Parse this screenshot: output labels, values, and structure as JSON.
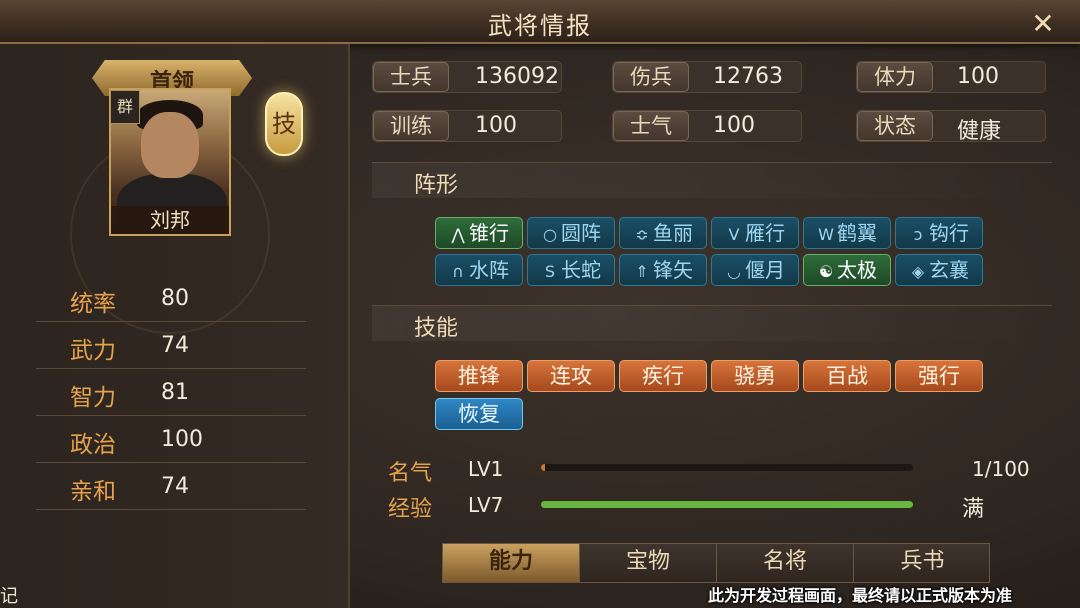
{
  "window": {
    "title": "武将情报",
    "close_label": "✕"
  },
  "general": {
    "leader_label": "首领",
    "faction": "群",
    "name": "刘邦",
    "skill_badge": "技",
    "stats": [
      {
        "label": "统率",
        "value": "80"
      },
      {
        "label": "武力",
        "value": "74"
      },
      {
        "label": "智力",
        "value": "81"
      },
      {
        "label": "政治",
        "value": "100"
      },
      {
        "label": "亲和",
        "value": "74"
      }
    ]
  },
  "info": [
    {
      "label": "士兵",
      "value": "136092"
    },
    {
      "label": "伤兵",
      "value": "12763"
    },
    {
      "label": "体力",
      "value": "100"
    },
    {
      "label": "训练",
      "value": "100"
    },
    {
      "label": "士气",
      "value": "100"
    },
    {
      "label": "状态",
      "value": "健康"
    }
  ],
  "formations": {
    "title": "阵形",
    "items": [
      {
        "label": "锥行",
        "icon": "⋀",
        "active": true
      },
      {
        "label": "圆阵",
        "icon": "○",
        "active": false
      },
      {
        "label": "鱼丽",
        "icon": "≎",
        "active": false
      },
      {
        "label": "雁行",
        "icon": "V",
        "active": false
      },
      {
        "label": "鹤翼",
        "icon": "W",
        "active": false
      },
      {
        "label": "钩行",
        "icon": "ↄ",
        "active": false
      },
      {
        "label": "水阵",
        "icon": "∩",
        "active": false
      },
      {
        "label": "长蛇",
        "icon": "S",
        "active": false
      },
      {
        "label": "锋矢",
        "icon": "⇑",
        "active": false
      },
      {
        "label": "偃月",
        "icon": "◡",
        "active": false
      },
      {
        "label": "太极",
        "icon": "☯",
        "active": true
      },
      {
        "label": "玄襄",
        "icon": "◈",
        "active": false
      }
    ]
  },
  "skills": {
    "title": "技能",
    "items": [
      {
        "label": "推锋",
        "color": "orange"
      },
      {
        "label": "连攻",
        "color": "orange"
      },
      {
        "label": "疾行",
        "color": "orange"
      },
      {
        "label": "骁勇",
        "color": "orange"
      },
      {
        "label": "百战",
        "color": "orange"
      },
      {
        "label": "强行",
        "color": "orange"
      },
      {
        "label": "恢复",
        "color": "blue"
      }
    ]
  },
  "fame": {
    "label": "名气",
    "level": "LV1",
    "progress_text": "1/100",
    "fraction": 0.01
  },
  "experience": {
    "label": "经验",
    "level": "LV7",
    "progress_text": "满",
    "fraction": 1.0
  },
  "tabs": [
    {
      "label": "能力",
      "active": true
    },
    {
      "label": "宝物",
      "active": false
    },
    {
      "label": "名将",
      "active": false
    },
    {
      "label": "兵书",
      "active": false
    }
  ],
  "notice": "此为开发过程画面，最终请以正式版本为准",
  "back_label": "记",
  "colors": {
    "accent_gold": "#c8a15c",
    "stat_label": "#e6a34d",
    "formation_active": "#2f6c3b",
    "skill_orange": "#c0602a",
    "skill_blue": "#2e88c4",
    "exp_bar": "#67b63f"
  }
}
